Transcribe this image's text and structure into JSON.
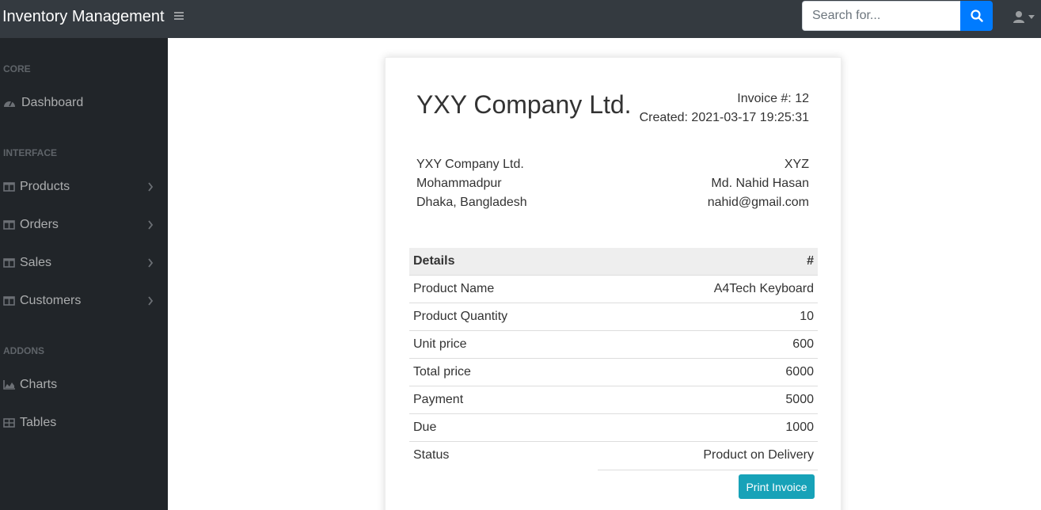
{
  "app": {
    "brand": "Inventory Management"
  },
  "search": {
    "placeholder": "Search for..."
  },
  "sidebar": {
    "sections": [
      {
        "heading": "CORE"
      },
      {
        "heading": "INTERFACE"
      },
      {
        "heading": "ADDONS"
      }
    ],
    "items": [
      {
        "label": "Dashboard",
        "icon": "tachometer-icon"
      },
      {
        "label": "Products",
        "icon": "columns-icon"
      },
      {
        "label": "Orders",
        "icon": "columns-icon"
      },
      {
        "label": "Sales",
        "icon": "columns-icon"
      },
      {
        "label": "Customers",
        "icon": "columns-icon"
      },
      {
        "label": "Charts",
        "icon": "area-chart-icon"
      },
      {
        "label": "Tables",
        "icon": "table-icon"
      }
    ]
  },
  "invoice": {
    "company": "YXY Company Ltd.",
    "number_line": "Invoice #: 12",
    "created_line": "Created: 2021-03-17 19:25:31",
    "from": [
      "YXY Company Ltd.",
      "Mohammadpur",
      "Dhaka, Bangladesh"
    ],
    "to": [
      "XYZ",
      "Md. Nahid Hasan",
      "nahid@gmail.com"
    ],
    "table_header": {
      "left": "Details",
      "right": "#"
    },
    "rows": [
      {
        "label": "Product Name",
        "value": "A4Tech Keyboard"
      },
      {
        "label": "Product Quantity",
        "value": "10"
      },
      {
        "label": "Unit price",
        "value": "600"
      },
      {
        "label": "Total price",
        "value": "6000"
      },
      {
        "label": "Payment",
        "value": "5000"
      },
      {
        "label": "Due",
        "value": "1000"
      },
      {
        "label": "Status",
        "value": "Product on Delivery"
      }
    ],
    "print_label": "Print Invoice"
  },
  "colors": {
    "navbar": "#343a40",
    "sidebar": "#212529",
    "primary": "#007bff",
    "info": "#17a2b8"
  }
}
